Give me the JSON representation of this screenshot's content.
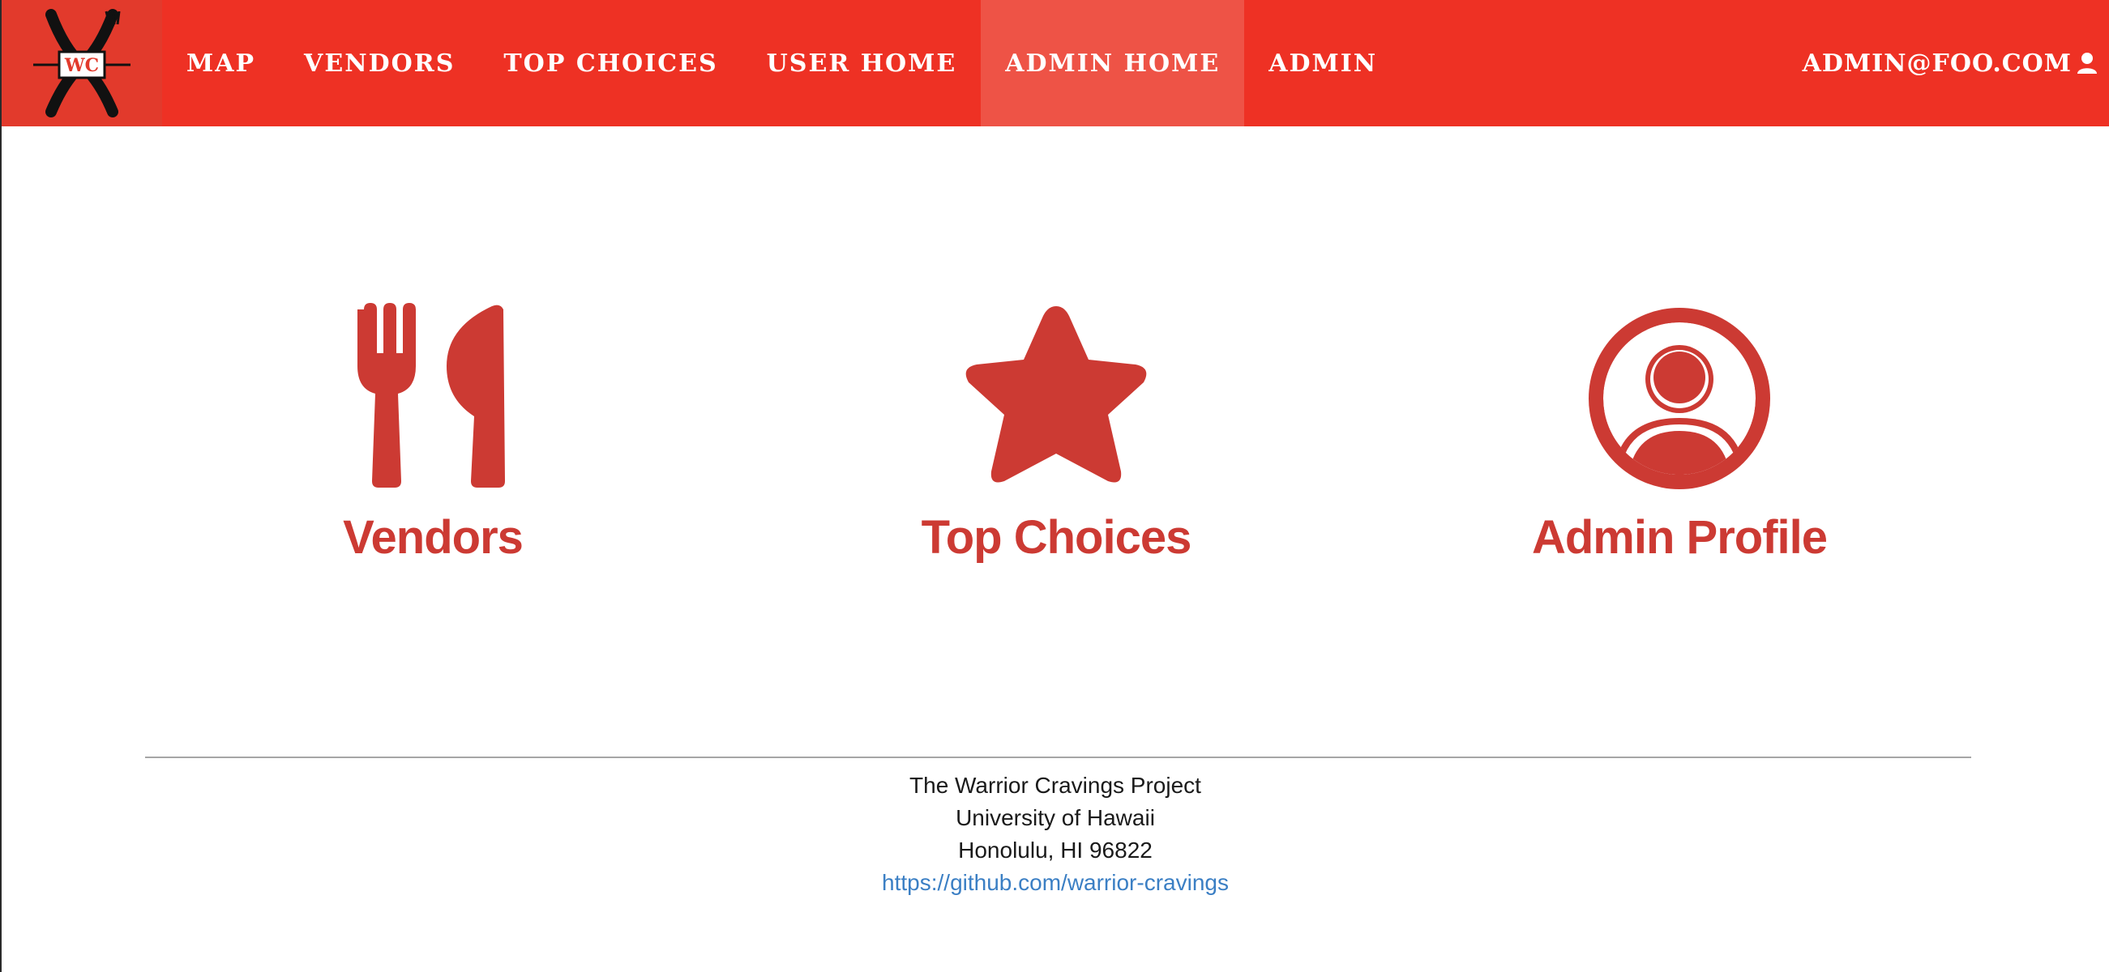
{
  "colors": {
    "nav_bg": "#ee3124",
    "nav_active_bg": "#ee5346",
    "accent": "#cc3a33",
    "link": "#3b7fc4"
  },
  "navbar": {
    "logo_text": "WC",
    "items": [
      {
        "label": "MAP",
        "active": false
      },
      {
        "label": "VENDORS",
        "active": false
      },
      {
        "label": "TOP CHOICES",
        "active": false
      },
      {
        "label": "USER HOME",
        "active": false
      },
      {
        "label": "ADMIN HOME",
        "active": true
      },
      {
        "label": "ADMIN",
        "active": false
      }
    ],
    "user_label": "ADMIN@FOO.COM",
    "user_icon": "user-icon"
  },
  "cards": [
    {
      "label": "Vendors",
      "icon": "fork-knife-icon"
    },
    {
      "label": "Top Choices",
      "icon": "star-icon"
    },
    {
      "label": "Admin Profile",
      "icon": "user-circle-icon"
    }
  ],
  "footer": {
    "line1": "The Warrior Cravings Project",
    "line2": "University of Hawaii",
    "line3": "Honolulu, HI 96822",
    "link": "https://github.com/warrior-cravings"
  }
}
